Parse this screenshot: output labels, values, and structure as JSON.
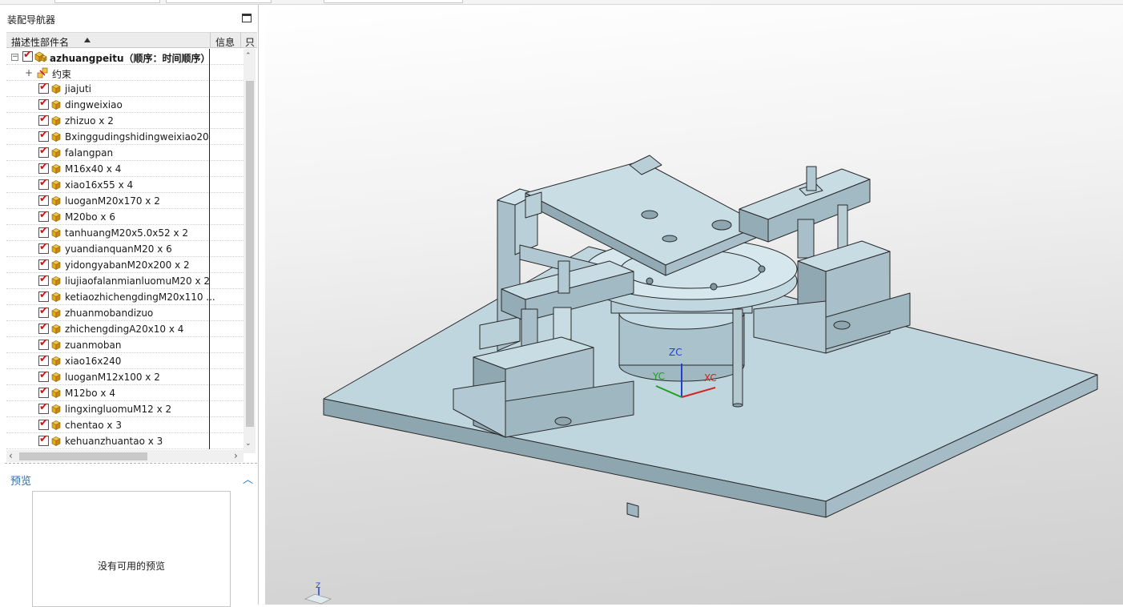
{
  "panel": {
    "title": "装配导航器",
    "columns": {
      "name": "描述性部件名",
      "info": "信息",
      "readonly": "只"
    }
  },
  "tree": {
    "root": {
      "name": "azhuangpeitu（顺序：时间顺序）",
      "checked": true,
      "expanded": true
    },
    "constraints": {
      "name": "约束"
    },
    "items": [
      {
        "name": "jiajuti"
      },
      {
        "name": "dingweixiao"
      },
      {
        "name": "zhizuo x 2"
      },
      {
        "name": "Bxinggudingshidingweixiao20"
      },
      {
        "name": "falangpan"
      },
      {
        "name": "M16x40 x 4"
      },
      {
        "name": "xiao16x55 x 4"
      },
      {
        "name": "luoganM20x170 x 2"
      },
      {
        "name": "M20bo x 6"
      },
      {
        "name": "tanhuangM20x5.0x52 x 2"
      },
      {
        "name": "yuandianquanM20 x 6"
      },
      {
        "name": "yidongyabanM20x200 x 2"
      },
      {
        "name": "liujiaofalanmianluomuM20 x 2"
      },
      {
        "name": "ketiaozhichengdingM20x110 ..."
      },
      {
        "name": "zhuanmobandizuo"
      },
      {
        "name": "zhichengdingA20x10 x 4"
      },
      {
        "name": "zuanmoban"
      },
      {
        "name": "xiao16x240"
      },
      {
        "name": "luoganM12x100 x 2"
      },
      {
        "name": "M12bo x 4"
      },
      {
        "name": "lingxingluomuM12 x 2"
      },
      {
        "name": "chentao x 3"
      },
      {
        "name": "kehuanzhuantao x 3"
      }
    ]
  },
  "preview": {
    "title": "预览",
    "message": "没有可用的预览"
  },
  "viewport": {
    "axes": {
      "zc": "ZC",
      "xc": "XC",
      "yc": "YC",
      "triad_z": "Z"
    }
  },
  "colors": {
    "checkbox_check": "#d01010",
    "part_icon": "#e8b020",
    "model_face": "#c8dde6",
    "model_edge": "#2a2a2a",
    "preview_title": "#2b6cb0",
    "axis_z": "#1f3fd6",
    "axis_x": "#d62020",
    "axis_y": "#20a020"
  }
}
